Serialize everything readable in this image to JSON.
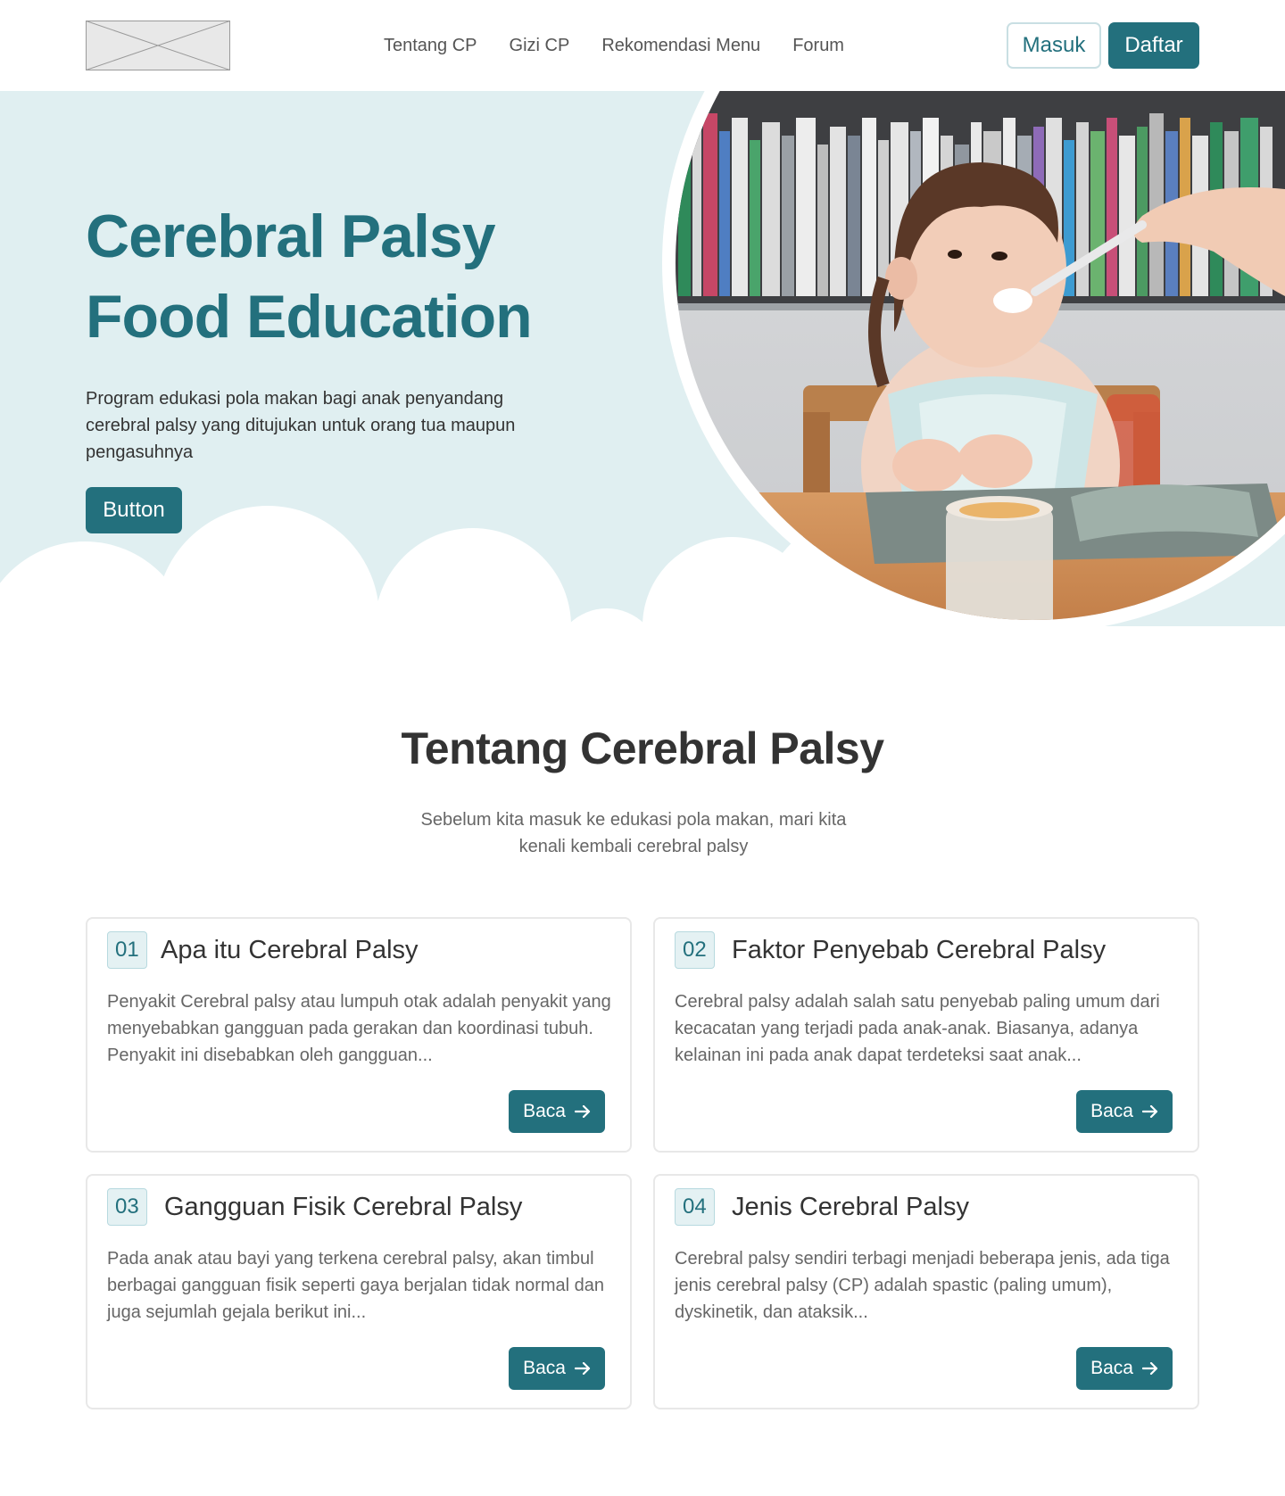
{
  "nav": {
    "links": [
      "Tentang CP",
      "Gizi CP",
      "Rekomendasi Menu",
      "Forum"
    ],
    "login_label": "Masuk",
    "register_label": "Daftar"
  },
  "hero": {
    "title_line1": "Cerebral Palsy",
    "title_line2": "Food Education",
    "description": "Program edukasi pola makan bagi anak penyandang cerebral palsy yang ditujukan untuk orang tua maupun pengasuhnya",
    "button_label": "Button"
  },
  "about": {
    "title": "Tentang Cerebral Palsy",
    "subtitle": "Sebelum kita masuk ke edukasi pola makan, mari kita kenali kembali cerebral palsy",
    "cards": [
      {
        "number": "01",
        "title": "Apa itu Cerebral Palsy",
        "text": "Penyakit Cerebral palsy atau lumpuh otak adalah penyakit yang menyebabkan gangguan pada gerakan dan koordinasi tubuh. Penyakit ini disebabkan oleh gangguan...",
        "button_label": "Baca"
      },
      {
        "number": "02",
        "title": "Faktor Penyebab Cerebral Palsy",
        "text": "Cerebral palsy adalah salah satu penyebab paling umum dari kecacatan yang terjadi pada anak-anak. Biasanya, adanya kelainan ini pada anak dapat terdeteksi saat anak...",
        "button_label": "Baca"
      },
      {
        "number": "03",
        "title": "Gangguan Fisik Cerebral Palsy",
        "text": "Pada anak atau bayi yang terkena cerebral palsy, akan timbul berbagai gangguan fisik seperti gaya berjalan tidak normal dan juga sejumlah gejala berikut ini...",
        "button_label": "Baca"
      },
      {
        "number": "04",
        "title": "Jenis Cerebral Palsy",
        "text": "Cerebral palsy sendiri terbagi menjadi beberapa jenis, ada tiga jenis cerebral palsy (CP) adalah spastic (paling umum), dyskinetik, dan ataksik...",
        "button_label": "Baca"
      }
    ]
  },
  "colors": {
    "primary": "#23707d",
    "hero_background": "#e0eff1",
    "badge_background": "#e4f1f3"
  }
}
